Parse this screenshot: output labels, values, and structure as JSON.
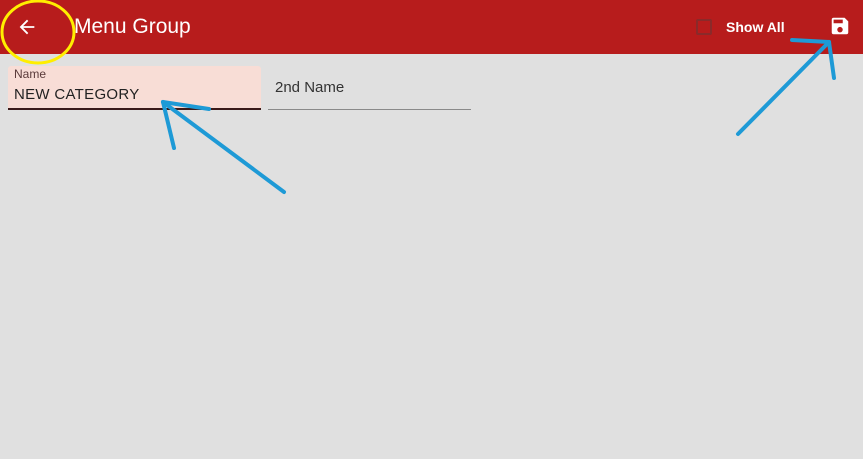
{
  "appbar": {
    "title": "Menu Group",
    "show_all_label": "Show All",
    "show_all_checked": false,
    "back_icon": "arrow-left-icon",
    "save_icon": "floppy-disk-icon",
    "color": "#b71c1c"
  },
  "form": {
    "name_label": "Name",
    "name_value": "NEW CATEGORY",
    "second_name_placeholder": "2nd Name"
  },
  "annotations": {
    "circle_color": "#ffee00",
    "arrow_color": "#1e9ad6"
  }
}
